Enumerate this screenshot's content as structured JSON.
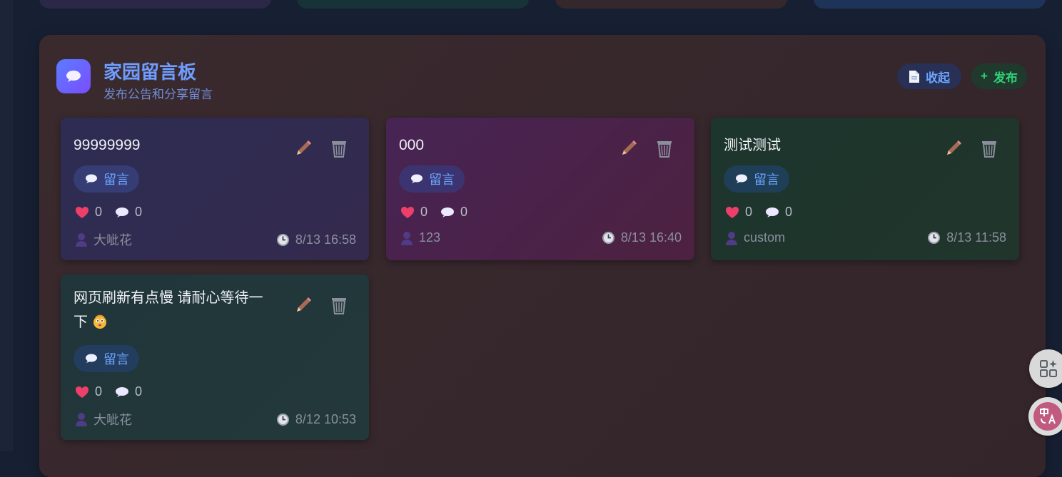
{
  "board": {
    "title": "家园留言板",
    "subtitle": "发布公告和分享留言",
    "collapse_label": "收起",
    "publish_label": "发布",
    "publish_prefix": "+"
  },
  "messages": [
    {
      "title": "99999999",
      "tag": "留言",
      "likes": "0",
      "comments": "0",
      "author": "大呲花",
      "time": "8/13 16:58"
    },
    {
      "title": "000",
      "tag": "留言",
      "likes": "0",
      "comments": "0",
      "author": "123",
      "time": "8/13 16:40"
    },
    {
      "title": "测试测试",
      "tag": "留言",
      "likes": "0",
      "comments": "0",
      "author": "custom",
      "time": "8/13 11:58"
    },
    {
      "title": "网页刷新有点慢 请耐心等待一下",
      "tag": "留言",
      "likes": "0",
      "comments": "0",
      "author": "大呲花",
      "time": "8/12 10:53"
    }
  ],
  "icons": {
    "board": "speech-bubble-icon",
    "collapse": "document-icon",
    "edit": "pencil-icon",
    "delete": "trash-icon",
    "like": "heart-icon",
    "comment": "speech-bubble-icon",
    "author": "user-icon",
    "time": "clock-icon"
  },
  "colors": {
    "accent": "#6f9cff",
    "publish": "#2fd176",
    "board_bg": "#3a2a2e"
  }
}
